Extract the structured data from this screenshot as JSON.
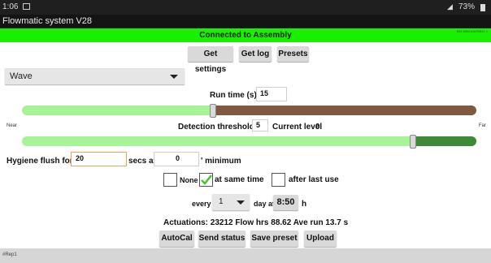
{
  "status_bar": {
    "time": "1:06",
    "battery": "73%"
  },
  "app": {
    "title": "Flowmatic system V28"
  },
  "connection": {
    "text": "Connected to Assembly",
    "serial": "S/N 58921067D541 1"
  },
  "toolbar": {
    "get_settings": "Get settings",
    "get_log": "Get log",
    "presets": "Presets"
  },
  "mode": {
    "selected": "Wave"
  },
  "run_time": {
    "label": "Run time (s)",
    "value": "15",
    "level": 0.42
  },
  "detection": {
    "near": "Near",
    "far": "Far",
    "label": "Detection threshold",
    "value": "5",
    "current_label": "Current level",
    "current_value": "0",
    "level": 0.86
  },
  "hygiene": {
    "label": "Hygiene flush for",
    "secs_value": "20",
    "secs_label": "secs at",
    "min_value": "0",
    "min_label": "' minimum",
    "none_label": "None",
    "same_time_label": "at same time",
    "after_label": "after last use",
    "none_checked": false,
    "same_time_checked": true,
    "after_checked": false
  },
  "schedule": {
    "every_label": "every",
    "every_value": "1",
    "day_at_label": "day at",
    "time": "8:50",
    "h_label": "h"
  },
  "stats": {
    "text": "Actuations: 23212  Flow hrs 88.62  Ave run 13.7 s"
  },
  "actions": {
    "autocal": "AutoCal",
    "send_status": "Send status",
    "save_preset": "Save preset",
    "upload": "Upload"
  },
  "footer": {
    "text": "#Rep1"
  },
  "colors": {
    "connected": "#18f000",
    "slider_green": "#a8f297",
    "slider_brown": "#805a40",
    "slider_dark_green": "#3f8a39",
    "check": "#47c22e",
    "focus": "#f0a050"
  }
}
